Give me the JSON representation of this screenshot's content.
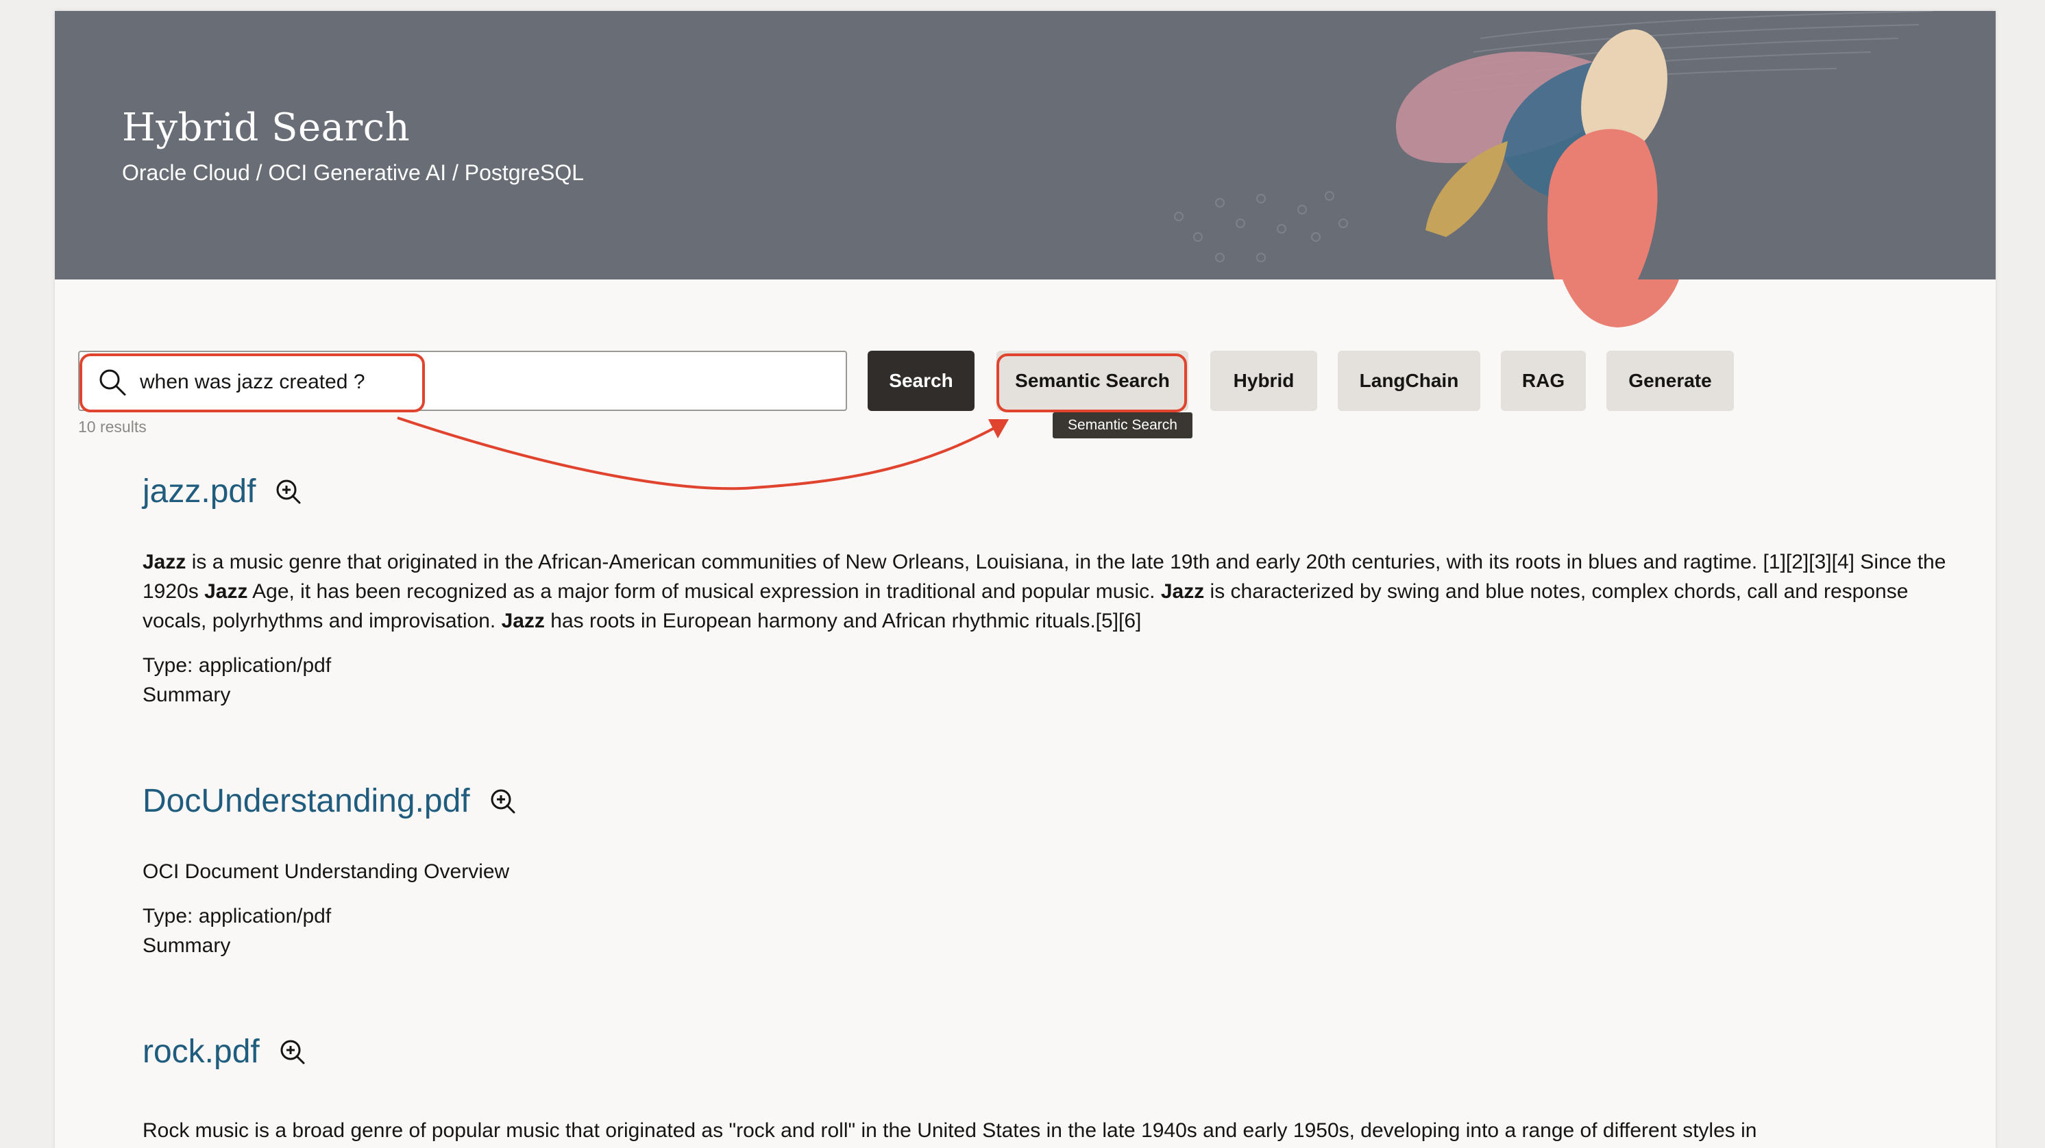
{
  "header": {
    "title": "Hybrid Search",
    "subtitle": "Oracle Cloud / OCI Generative AI / PostgreSQL"
  },
  "search": {
    "value": "when was jazz created ?",
    "placeholder": "",
    "results_count": "10 results"
  },
  "buttons": {
    "search": "Search",
    "semantic": "Semantic Search",
    "hybrid": "Hybrid",
    "langchain": "LangChain",
    "rag": "RAG",
    "generate": "Generate"
  },
  "tooltip": "Semantic Search",
  "results": [
    {
      "title": "jazz.pdf",
      "snippet_parts": [
        {
          "bold": true,
          "text": "Jazz"
        },
        {
          "bold": false,
          "text": " is a music genre that originated in the African-American communities of New Orleans, Louisiana, in the late 19th and early 20th centuries, with its roots in blues and ragtime. [1][2][3][4] Since the 1920s "
        },
        {
          "bold": true,
          "text": "Jazz"
        },
        {
          "bold": false,
          "text": " Age, it has been recognized as a major form of musical expression in traditional and popular music. "
        },
        {
          "bold": true,
          "text": "Jazz"
        },
        {
          "bold": false,
          "text": " is characterized by swing and blue notes, complex chords, call and response vocals, polyrhythms and improvisation. "
        },
        {
          "bold": true,
          "text": "Jazz"
        },
        {
          "bold": false,
          "text": " has roots in European harmony and African rhythmic rituals.[5][6]"
        }
      ],
      "type": "Type: application/pdf",
      "summary": "Summary"
    },
    {
      "title": "DocUnderstanding.pdf",
      "snippet": "OCI Document Understanding Overview",
      "type": "Type: application/pdf",
      "summary": "Summary"
    },
    {
      "title": "rock.pdf",
      "snippet": "Rock music is a broad genre of popular music that originated as \"rock and roll\" in the United States in the late 1940s and early 1950s, developing into a range of different styles in"
    }
  ],
  "colors": {
    "banner": "#696e76",
    "primary_button": "#312d2a",
    "link": "#1f5c7e",
    "annotation": "#e0442e"
  },
  "icons": [
    "search-icon",
    "zoom-in-icon"
  ]
}
